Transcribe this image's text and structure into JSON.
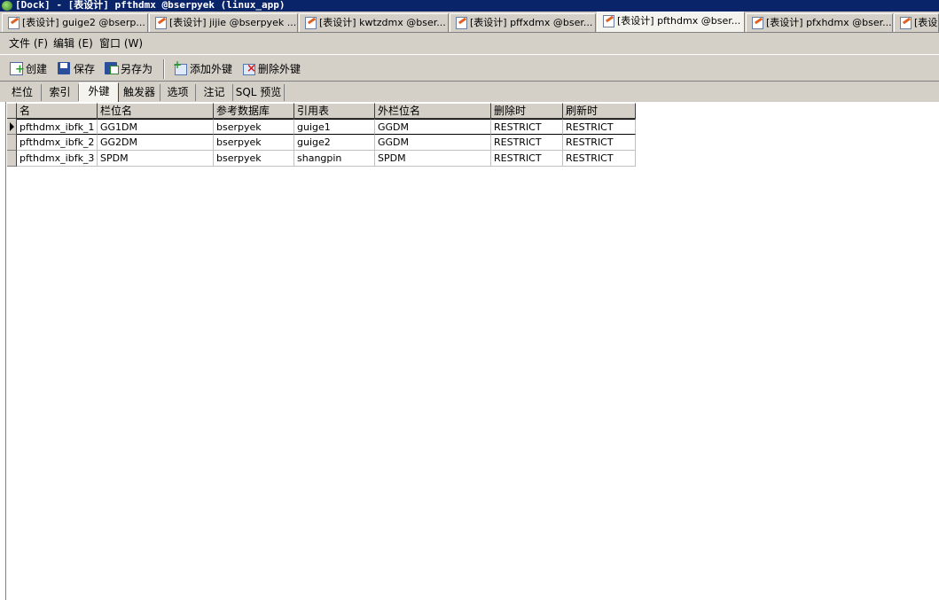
{
  "window": {
    "title": "[Dock] - [表设计] pfthdmx @bserpyek (linux_app)"
  },
  "doc_tabs": [
    {
      "label": "[表设计] guige2 @bserp...",
      "active": false
    },
    {
      "label": "[表设计] jijie @bserpyek ...",
      "active": false
    },
    {
      "label": "[表设计] kwtzdmx @bser...",
      "active": false
    },
    {
      "label": "[表设计] pffxdmx @bser...",
      "active": false
    },
    {
      "label": "[表设计] pfthdmx @bser...",
      "active": true
    },
    {
      "label": "[表设计] pfxhdmx @bser...",
      "active": false
    },
    {
      "label": "[表设",
      "active": false
    }
  ],
  "menu": [
    {
      "label": "文件 (F)"
    },
    {
      "label": "编辑 (E)"
    },
    {
      "label": "窗口 (W)"
    }
  ],
  "toolbar": {
    "create": "创建",
    "save": "保存",
    "save_as": "另存为",
    "add_fk": "添加外键",
    "delete_fk": "删除外键"
  },
  "sub_tabs": [
    {
      "label": "栏位",
      "active": false
    },
    {
      "label": "索引",
      "active": false
    },
    {
      "label": "外键",
      "active": true
    },
    {
      "label": "触发器",
      "active": false
    },
    {
      "label": "选项",
      "active": false
    },
    {
      "label": "注记",
      "active": false
    },
    {
      "label": "SQL 预览",
      "active": false
    }
  ],
  "grid": {
    "columns": [
      "名",
      "栏位名",
      "参考数据库",
      "引用表",
      "外栏位名",
      "删除时",
      "刷新时"
    ],
    "rows": [
      [
        "pfthdmx_ibfk_1",
        "GG1DM",
        "bserpyek",
        "guige1",
        "GGDM",
        "RESTRICT",
        "RESTRICT"
      ],
      [
        "pfthdmx_ibfk_2",
        "GG2DM",
        "bserpyek",
        "guige2",
        "GGDM",
        "RESTRICT",
        "RESTRICT"
      ],
      [
        "pfthdmx_ibfk_3",
        "SPDM",
        "bserpyek",
        "shangpin",
        "SPDM",
        "RESTRICT",
        "RESTRICT"
      ]
    ],
    "current_row": 1
  }
}
